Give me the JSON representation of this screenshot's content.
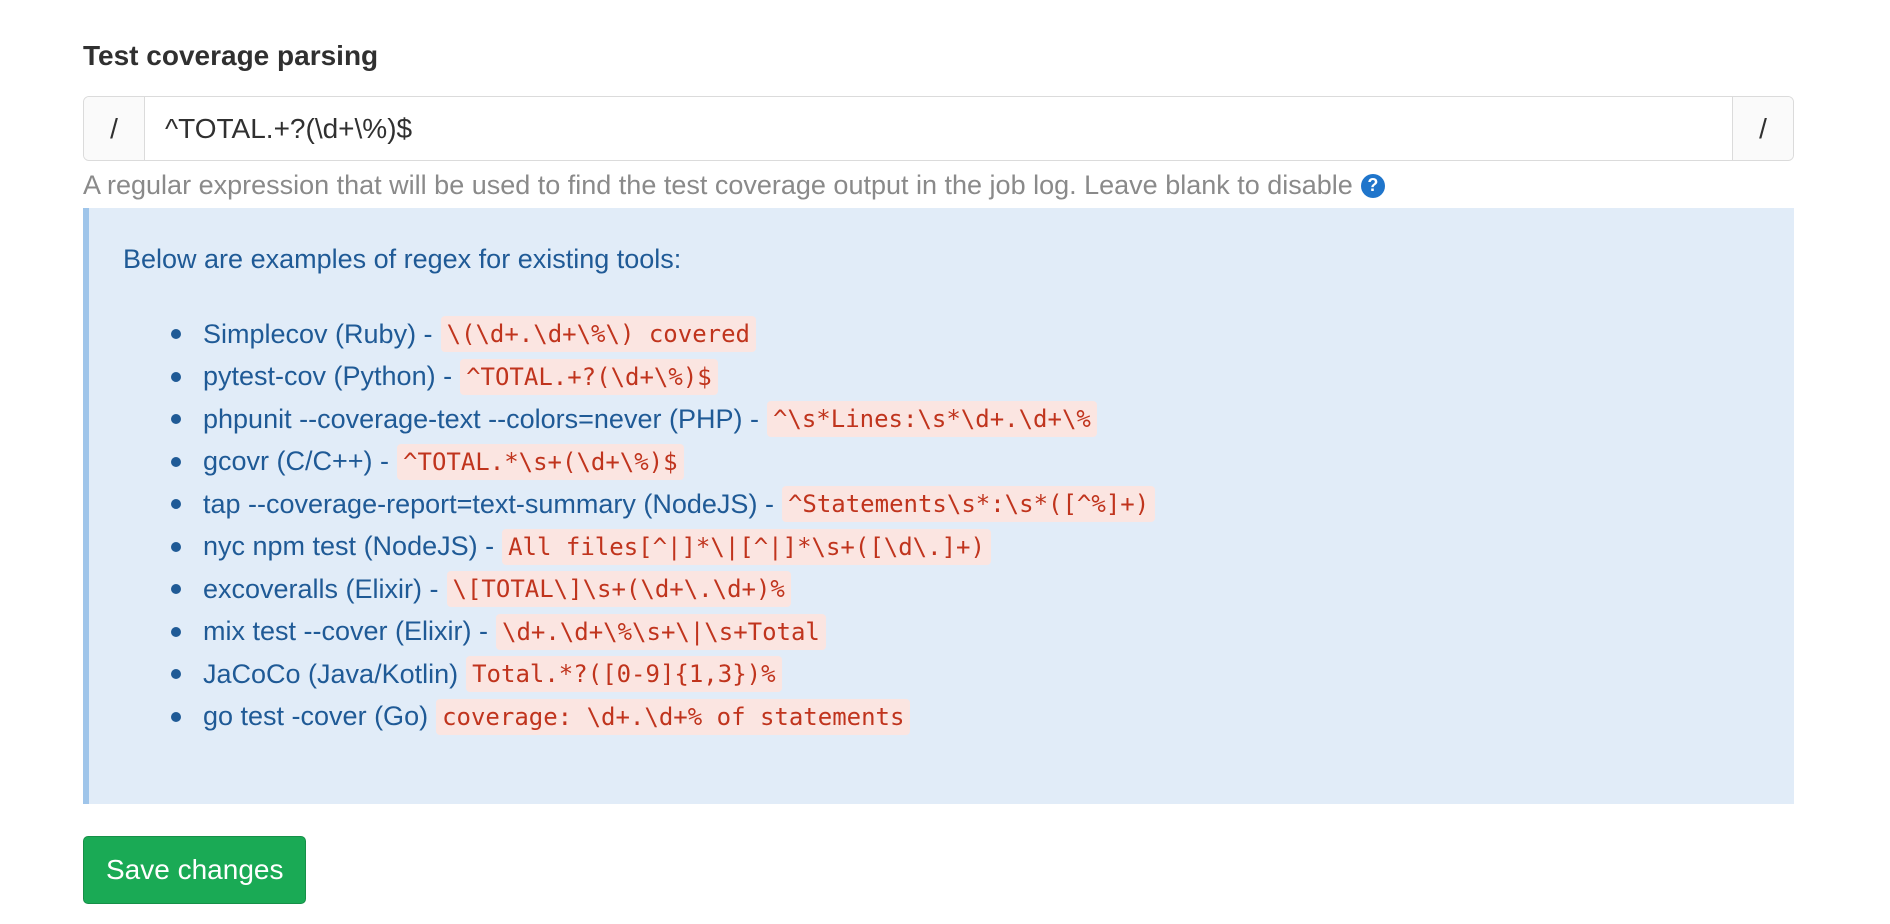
{
  "section": {
    "label": "Test coverage parsing"
  },
  "regex_field": {
    "prefix": "/",
    "value": "^TOTAL.+?(\\d+\\%)$",
    "suffix": "/"
  },
  "help": {
    "text": "A regular expression that will be used to find the test coverage output in the job log. Leave blank to disable",
    "icon": "question-circle-icon",
    "icon_glyph": "?"
  },
  "info": {
    "intro": "Below are examples of regex for existing tools:",
    "examples": [
      {
        "tool": "Simplecov (Ruby) -",
        "regex": "\\(\\d+.\\d+\\%\\) covered"
      },
      {
        "tool": "pytest-cov (Python) -",
        "regex": "^TOTAL.+?(\\d+\\%)$"
      },
      {
        "tool": "phpunit --coverage-text --colors=never (PHP) -",
        "regex": "^\\s*Lines:\\s*\\d+.\\d+\\%"
      },
      {
        "tool": "gcovr (C/C++) -",
        "regex": "^TOTAL.*\\s+(\\d+\\%)$"
      },
      {
        "tool": "tap --coverage-report=text-summary (NodeJS) -",
        "regex": "^Statements\\s*:\\s*([^%]+)"
      },
      {
        "tool": "nyc npm test (NodeJS) -",
        "regex": "All files[^|]*\\|[^|]*\\s+([\\d\\.]+)"
      },
      {
        "tool": "excoveralls (Elixir) -",
        "regex": "\\[TOTAL\\]\\s+(\\d+\\.\\d+)%"
      },
      {
        "tool": "mix test --cover (Elixir) -",
        "regex": "\\d+.\\d+\\%\\s+\\|\\s+Total"
      },
      {
        "tool": "JaCoCo (Java/Kotlin)",
        "regex": "Total.*?([0-9]{1,3})%"
      },
      {
        "tool": "go test -cover (Go)",
        "regex": "coverage: \\d+.\\d+% of statements"
      }
    ]
  },
  "actions": {
    "save_label": "Save changes"
  },
  "colors": {
    "info_background": "#e1ecf8",
    "info_text": "#1f5a96",
    "code_text": "#c0341d",
    "code_background": "#fbe5e1",
    "save_button": "#1aaa55"
  }
}
